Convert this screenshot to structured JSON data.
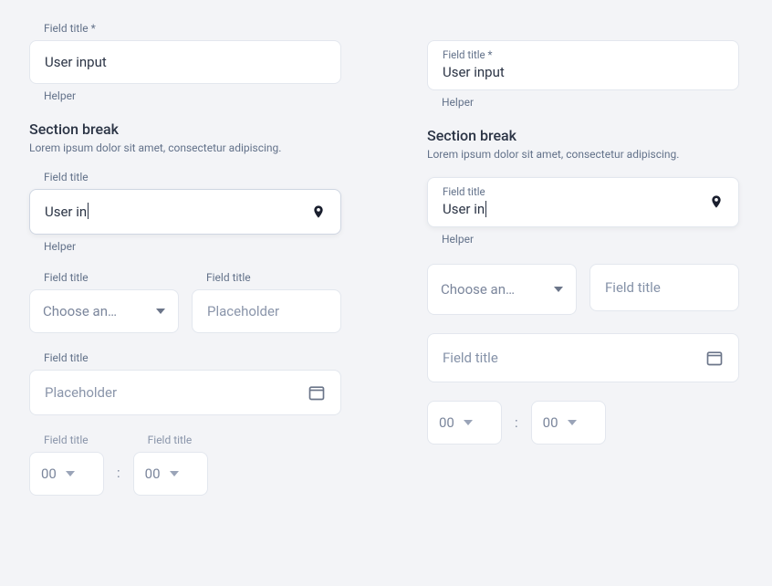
{
  "left": {
    "field1": {
      "label": "Field title *",
      "value": "User input",
      "helper": "Helper"
    },
    "section": {
      "title": "Section break",
      "desc": "Lorem ipsum dolor sit amet, consectetur adipiscing."
    },
    "field2": {
      "label": "Field title",
      "value": "User in",
      "helper": "Helper"
    },
    "select1": {
      "label": "Field title",
      "text": "Choose an…"
    },
    "field3": {
      "label": "Field title",
      "placeholder": "Placeholder"
    },
    "date": {
      "label": "Field title",
      "placeholder": "Placeholder"
    },
    "timeA": {
      "label": "Field title",
      "value": "00"
    },
    "timeB": {
      "label": "Field title",
      "value": "00"
    },
    "colon": ":"
  },
  "right": {
    "field1": {
      "label": "Field title *",
      "value": "User input",
      "helper": "Helper"
    },
    "section": {
      "title": "Section break",
      "desc": "Lorem ipsum dolor sit amet, consectetur adipiscing."
    },
    "field2": {
      "label": "Field title",
      "value": "User in",
      "helper": "Helper"
    },
    "select1": {
      "text": "Choose an…"
    },
    "field3": {
      "placeholder": "Field title"
    },
    "date": {
      "placeholder": "Field title"
    },
    "timeA": {
      "value": "00"
    },
    "timeB": {
      "value": "00"
    },
    "colon": ":"
  }
}
